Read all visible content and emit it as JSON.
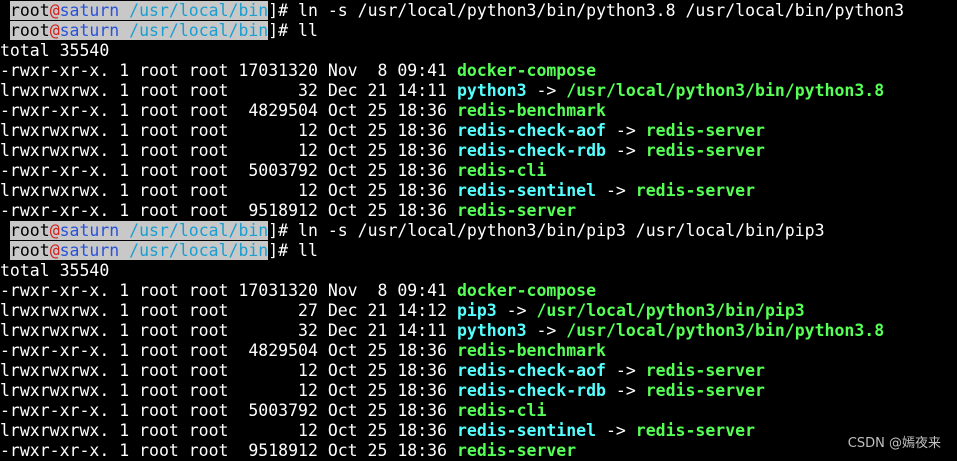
{
  "colors": {
    "background": "#000000",
    "exec_file": "#55ff55",
    "symlink": "#55ffff",
    "prompt_highlight": "#c8c8c8"
  },
  "lines": [
    {
      "type": "prompt",
      "user": "root",
      "at": "@",
      "host": "saturn",
      "path": " /usr/local/bin",
      "cmd": "]# ln -s /usr/local/python3/bin/python3.8 /usr/local/bin/python3"
    },
    {
      "type": "prompt",
      "user": "root",
      "at": "@",
      "host": "saturn",
      "path": " /usr/local/bin",
      "cmd": "]# ll"
    },
    {
      "type": "text",
      "text": "total 35540"
    },
    {
      "type": "entry",
      "meta": "-rwxr-xr-x. 1 root root 17031320 Nov  8 09:41 ",
      "name": "docker-compose",
      "name_color": "green"
    },
    {
      "type": "entry",
      "meta": "lrwxrwxrwx. 1 root root       32 Dec 21 14:11 ",
      "name": "python3",
      "name_color": "cyan",
      "arrow": " -> ",
      "target": "/usr/local/python3/bin/python3.8",
      "target_color": "green"
    },
    {
      "type": "entry",
      "meta": "-rwxr-xr-x. 1 root root  4829504 Oct 25 18:36 ",
      "name": "redis-benchmark",
      "name_color": "green"
    },
    {
      "type": "entry",
      "meta": "lrwxrwxrwx. 1 root root       12 Oct 25 18:36 ",
      "name": "redis-check-aof",
      "name_color": "cyan",
      "arrow": " -> ",
      "target": "redis-server",
      "target_color": "green"
    },
    {
      "type": "entry",
      "meta": "lrwxrwxrwx. 1 root root       12 Oct 25 18:36 ",
      "name": "redis-check-rdb",
      "name_color": "cyan",
      "arrow": " -> ",
      "target": "redis-server",
      "target_color": "green"
    },
    {
      "type": "entry",
      "meta": "-rwxr-xr-x. 1 root root  5003792 Oct 25 18:36 ",
      "name": "redis-cli",
      "name_color": "green"
    },
    {
      "type": "entry",
      "meta": "lrwxrwxrwx. 1 root root       12 Oct 25 18:36 ",
      "name": "redis-sentinel",
      "name_color": "cyan",
      "arrow": " -> ",
      "target": "redis-server",
      "target_color": "green"
    },
    {
      "type": "entry",
      "meta": "-rwxr-xr-x. 1 root root  9518912 Oct 25 18:36 ",
      "name": "redis-server",
      "name_color": "green"
    },
    {
      "type": "prompt",
      "user": "root",
      "at": "@",
      "host": "saturn",
      "path": " /usr/local/bin",
      "cmd": "]# ln -s /usr/local/python3/bin/pip3 /usr/local/bin/pip3"
    },
    {
      "type": "prompt",
      "user": "root",
      "at": "@",
      "host": "saturn",
      "path": " /usr/local/bin",
      "cmd": "]# ll"
    },
    {
      "type": "text",
      "text": "total 35540"
    },
    {
      "type": "entry",
      "meta": "-rwxr-xr-x. 1 root root 17031320 Nov  8 09:41 ",
      "name": "docker-compose",
      "name_color": "green"
    },
    {
      "type": "entry",
      "meta": "lrwxrwxrwx. 1 root root       27 Dec 21 14:12 ",
      "name": "pip3",
      "name_color": "cyan",
      "arrow": " -> ",
      "target": "/usr/local/python3/bin/pip3",
      "target_color": "green"
    },
    {
      "type": "entry",
      "meta": "lrwxrwxrwx. 1 root root       32 Dec 21 14:11 ",
      "name": "python3",
      "name_color": "cyan",
      "arrow": " -> ",
      "target": "/usr/local/python3/bin/python3.8",
      "target_color": "green"
    },
    {
      "type": "entry",
      "meta": "-rwxr-xr-x. 1 root root  4829504 Oct 25 18:36 ",
      "name": "redis-benchmark",
      "name_color": "green"
    },
    {
      "type": "entry",
      "meta": "lrwxrwxrwx. 1 root root       12 Oct 25 18:36 ",
      "name": "redis-check-aof",
      "name_color": "cyan",
      "arrow": " -> ",
      "target": "redis-server",
      "target_color": "green"
    },
    {
      "type": "entry",
      "meta": "lrwxrwxrwx. 1 root root       12 Oct 25 18:36 ",
      "name": "redis-check-rdb",
      "name_color": "cyan",
      "arrow": " -> ",
      "target": "redis-server",
      "target_color": "green"
    },
    {
      "type": "entry",
      "meta": "-rwxr-xr-x. 1 root root  5003792 Oct 25 18:36 ",
      "name": "redis-cli",
      "name_color": "green"
    },
    {
      "type": "entry",
      "meta": "lrwxrwxrwx. 1 root root       12 Oct 25 18:36 ",
      "name": "redis-sentinel",
      "name_color": "cyan",
      "arrow": " -> ",
      "target": "redis-server",
      "target_color": "green"
    },
    {
      "type": "entry",
      "meta": "-rwxr-xr-x. 1 root root  9518912 Oct 25 18:36 ",
      "name": "redis-server",
      "name_color": "green"
    }
  ],
  "watermark": "CSDN @嫣夜来"
}
